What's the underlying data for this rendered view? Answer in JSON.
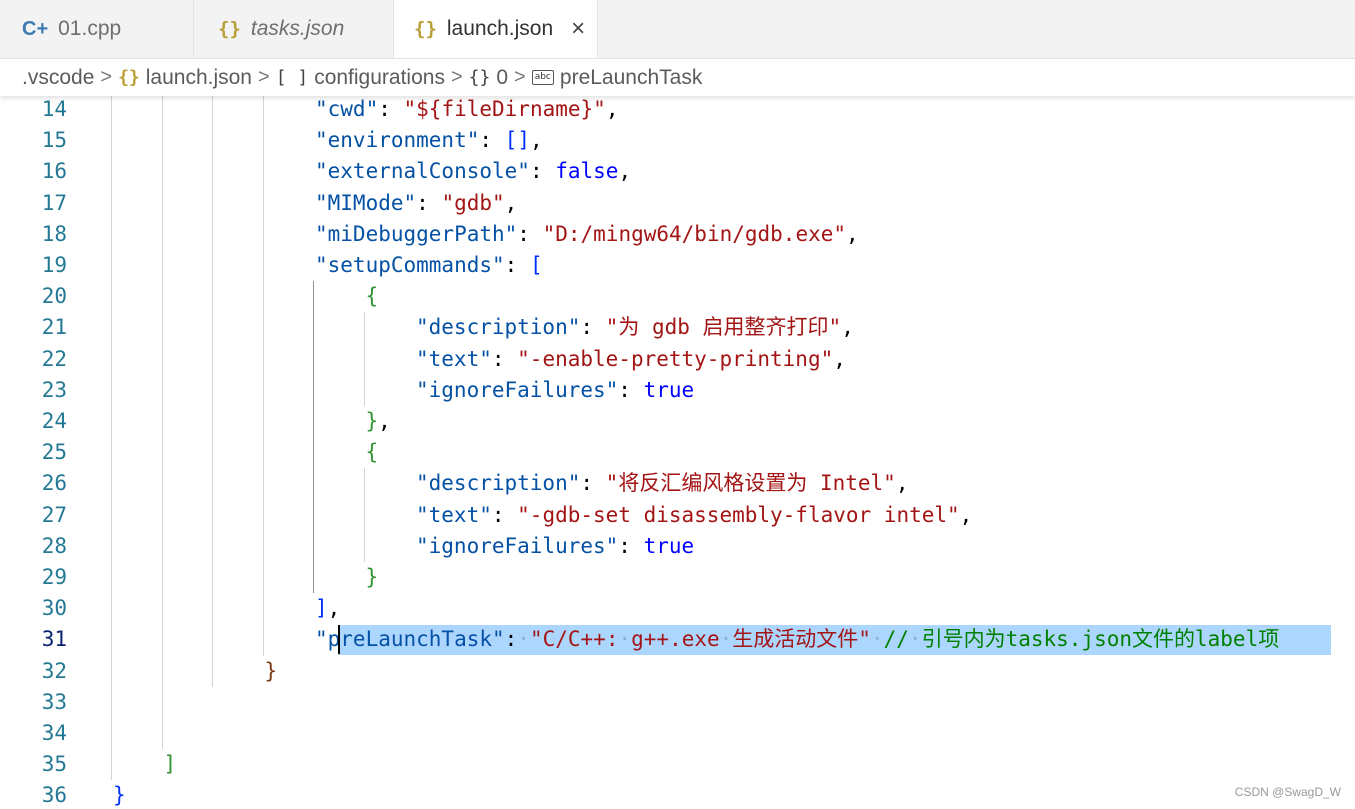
{
  "tabs": [
    {
      "label": "01.cpp",
      "icon": "cpp-icon",
      "icon_glyph": "C+",
      "italic": false,
      "active": false
    },
    {
      "label": "tasks.json",
      "icon": "json-icon",
      "icon_glyph": "{}",
      "italic": true,
      "active": false
    },
    {
      "label": "launch.json",
      "icon": "json-icon",
      "icon_glyph": "{}",
      "italic": false,
      "active": true,
      "close": "×"
    }
  ],
  "breadcrumb": {
    "items": [
      {
        "label": ".vscode",
        "icon": ""
      },
      {
        "label": "launch.json",
        "icon": "{}"
      },
      {
        "label": "configurations",
        "icon": "[ ]"
      },
      {
        "label": "0",
        "icon": "{}"
      },
      {
        "label": "preLaunchTask",
        "icon": "abc"
      }
    ],
    "separator": ">"
  },
  "editor": {
    "current_line": 31,
    "lines": [
      {
        "n": "14",
        "indent": 4,
        "tokens": [
          [
            "k",
            "\"cwd\""
          ],
          [
            "p",
            ": "
          ],
          [
            "s",
            "\"${fileDirname}\""
          ],
          [
            "p",
            ","
          ]
        ]
      },
      {
        "n": "15",
        "indent": 4,
        "tokens": [
          [
            "k",
            "\"environment\""
          ],
          [
            "p",
            ": "
          ],
          [
            "b1",
            "[]"
          ],
          [
            "p",
            ","
          ]
        ]
      },
      {
        "n": "16",
        "indent": 4,
        "tokens": [
          [
            "k",
            "\"externalConsole\""
          ],
          [
            "p",
            ": "
          ],
          [
            "kw",
            "false"
          ],
          [
            "p",
            ","
          ]
        ]
      },
      {
        "n": "17",
        "indent": 4,
        "tokens": [
          [
            "k",
            "\"MIMode\""
          ],
          [
            "p",
            ": "
          ],
          [
            "s",
            "\"gdb\""
          ],
          [
            "p",
            ","
          ]
        ]
      },
      {
        "n": "18",
        "indent": 4,
        "tokens": [
          [
            "k",
            "\"miDebuggerPath\""
          ],
          [
            "p",
            ": "
          ],
          [
            "s",
            "\"D:/mingw64/bin/gdb.exe\""
          ],
          [
            "p",
            ","
          ]
        ]
      },
      {
        "n": "19",
        "indent": 4,
        "tokens": [
          [
            "k",
            "\"setupCommands\""
          ],
          [
            "p",
            ": "
          ],
          [
            "b1",
            "["
          ]
        ]
      },
      {
        "n": "20",
        "indent": 5,
        "tokens": [
          [
            "b2",
            "{"
          ]
        ]
      },
      {
        "n": "21",
        "indent": 6,
        "tokens": [
          [
            "k",
            "\"description\""
          ],
          [
            "p",
            ": "
          ],
          [
            "s",
            "\"为 gdb 启用整齐打印\""
          ],
          [
            "p",
            ","
          ]
        ]
      },
      {
        "n": "22",
        "indent": 6,
        "tokens": [
          [
            "k",
            "\"text\""
          ],
          [
            "p",
            ": "
          ],
          [
            "s",
            "\"-enable-pretty-printing\""
          ],
          [
            "p",
            ","
          ]
        ]
      },
      {
        "n": "23",
        "indent": 6,
        "tokens": [
          [
            "k",
            "\"ignoreFailures\""
          ],
          [
            "p",
            ": "
          ],
          [
            "kw",
            "true"
          ]
        ]
      },
      {
        "n": "24",
        "indent": 5,
        "tokens": [
          [
            "b2",
            "}"
          ],
          [
            "p",
            ","
          ]
        ]
      },
      {
        "n": "25",
        "indent": 5,
        "tokens": [
          [
            "b2",
            "{"
          ]
        ]
      },
      {
        "n": "26",
        "indent": 6,
        "tokens": [
          [
            "k",
            "\"description\""
          ],
          [
            "p",
            ": "
          ],
          [
            "s",
            "\"将反汇编风格设置为 Intel\""
          ],
          [
            "p",
            ","
          ]
        ]
      },
      {
        "n": "27",
        "indent": 6,
        "tokens": [
          [
            "k",
            "\"text\""
          ],
          [
            "p",
            ": "
          ],
          [
            "s",
            "\"-gdb-set disassembly-flavor intel\""
          ],
          [
            "p",
            ","
          ]
        ]
      },
      {
        "n": "28",
        "indent": 6,
        "tokens": [
          [
            "k",
            "\"ignoreFailures\""
          ],
          [
            "p",
            ": "
          ],
          [
            "kw",
            "true"
          ]
        ]
      },
      {
        "n": "29",
        "indent": 5,
        "tokens": [
          [
            "b2",
            "}"
          ]
        ]
      },
      {
        "n": "30",
        "indent": 4,
        "tokens": [
          [
            "b1",
            "]"
          ],
          [
            "p",
            ","
          ]
        ]
      },
      {
        "n": "31",
        "indent": 4,
        "tokens": [
          [
            "k",
            "\"preLaunchTask\""
          ],
          [
            "p",
            ":"
          ],
          [
            "ws",
            "·"
          ],
          [
            "s",
            "\"C/C++:"
          ],
          [
            "ws",
            "·"
          ],
          [
            "s",
            "g++.exe"
          ],
          [
            "ws",
            "·"
          ],
          [
            "s",
            "生成活动文件\""
          ],
          [
            "ws",
            "·"
          ],
          [
            "cm",
            "//"
          ],
          [
            "ws",
            "·"
          ],
          [
            "cm",
            "引号内为tasks.json文件的label项"
          ]
        ]
      },
      {
        "n": "32",
        "indent": 3,
        "tokens": [
          [
            "b3",
            "}"
          ]
        ]
      },
      {
        "n": "33",
        "indent": 0,
        "tokens": []
      },
      {
        "n": "34",
        "indent": 0,
        "tokens": []
      },
      {
        "n": "35",
        "indent": 1,
        "tokens": [
          [
            "b2",
            "]"
          ]
        ]
      },
      {
        "n": "36",
        "indent": 0,
        "tokens": [
          [
            "b1",
            "}"
          ]
        ]
      }
    ]
  },
  "watermark": "CSDN @SwagD_W"
}
